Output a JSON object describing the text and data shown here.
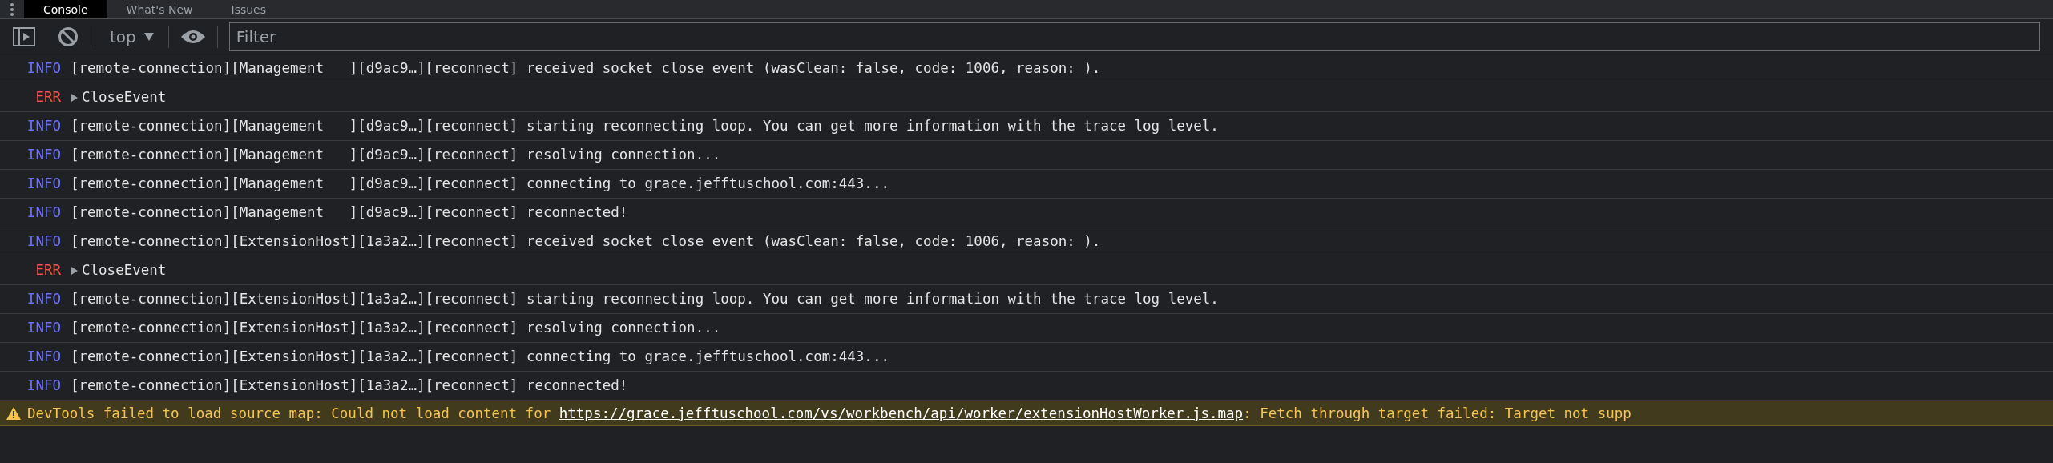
{
  "tabs": [
    {
      "label": "Console",
      "selected": true
    },
    {
      "label": "What's New",
      "selected": false
    },
    {
      "label": "Issues",
      "selected": false
    }
  ],
  "toolbar": {
    "context": "top",
    "filter": {
      "placeholder": "Filter"
    }
  },
  "messages": [
    {
      "kind": "info",
      "level": "INFO",
      "text": "[remote-connection][Management   ][d9ac9…][reconnect] received socket close event (wasClean: false, code: 1006, reason: )."
    },
    {
      "kind": "error",
      "level": "ERR",
      "text": "CloseEvent"
    },
    {
      "kind": "info",
      "level": "INFO",
      "text": "[remote-connection][Management   ][d9ac9…][reconnect] starting reconnecting loop. You can get more information with the trace log level."
    },
    {
      "kind": "info",
      "level": "INFO",
      "text": "[remote-connection][Management   ][d9ac9…][reconnect] resolving connection..."
    },
    {
      "kind": "info",
      "level": "INFO",
      "text": "[remote-connection][Management   ][d9ac9…][reconnect] connecting to grace.jefftuschool.com:443..."
    },
    {
      "kind": "info",
      "level": "INFO",
      "text": "[remote-connection][Management   ][d9ac9…][reconnect] reconnected!"
    },
    {
      "kind": "info",
      "level": "INFO",
      "text": "[remote-connection][ExtensionHost][1a3a2…][reconnect] received socket close event (wasClean: false, code: 1006, reason: )."
    },
    {
      "kind": "error",
      "level": "ERR",
      "text": "CloseEvent"
    },
    {
      "kind": "info",
      "level": "INFO",
      "text": "[remote-connection][ExtensionHost][1a3a2…][reconnect] starting reconnecting loop. You can get more information with the trace log level."
    },
    {
      "kind": "info",
      "level": "INFO",
      "text": "[remote-connection][ExtensionHost][1a3a2…][reconnect] resolving connection..."
    },
    {
      "kind": "info",
      "level": "INFO",
      "text": "[remote-connection][ExtensionHost][1a3a2…][reconnect] connecting to grace.jefftuschool.com:443..."
    },
    {
      "kind": "info",
      "level": "INFO",
      "text": "[remote-connection][ExtensionHost][1a3a2…][reconnect] reconnected!"
    }
  ],
  "warning": {
    "prefix": "DevTools failed to load source map: Could not load content for",
    "link": "https://grace.jefftuschool.com/vs/workbench/api/worker/extensionHostWorker.js.map",
    "suffix": ": Fetch through target failed: Target not supp"
  }
}
